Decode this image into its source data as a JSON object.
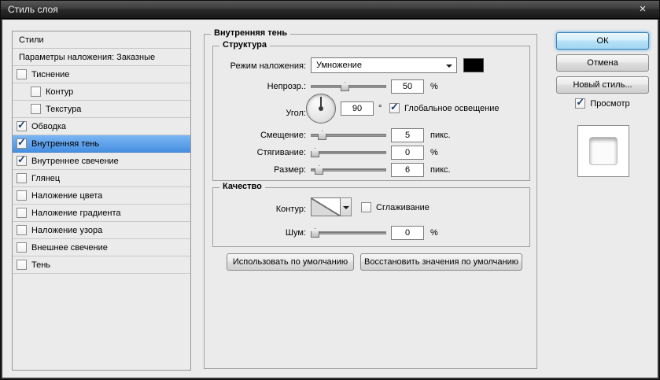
{
  "window": {
    "title": "Стиль слоя",
    "close_glyph": "×"
  },
  "styles_panel": {
    "header": "Стили",
    "blending_options": "Параметры наложения: Заказные",
    "items": [
      {
        "label": "Тиснение",
        "checked": false,
        "check": ""
      },
      {
        "label": "Контур",
        "checked": false,
        "check": ""
      },
      {
        "label": "Текстура",
        "checked": false,
        "check": ""
      },
      {
        "label": "Обводка",
        "checked": true,
        "check": "✓"
      },
      {
        "label": "Внутренняя тень",
        "checked": true,
        "check": "✓",
        "selected": true
      },
      {
        "label": "Внутреннее свечение",
        "checked": true,
        "check": "✓"
      },
      {
        "label": "Глянец",
        "checked": false,
        "check": ""
      },
      {
        "label": "Наложение цвета",
        "checked": false,
        "check": ""
      },
      {
        "label": "Наложение градиента",
        "checked": false,
        "check": ""
      },
      {
        "label": "Наложение узора",
        "checked": false,
        "check": ""
      },
      {
        "label": "Внешнее свечение",
        "checked": false,
        "check": ""
      },
      {
        "label": "Тень",
        "checked": false,
        "check": ""
      }
    ]
  },
  "effect": {
    "title": "Внутренняя тень",
    "structure": {
      "title": "Структура",
      "blend_mode": {
        "label": "Режим наложения:",
        "value": "Умножение",
        "color": "#000000"
      },
      "opacity": {
        "label": "Непрозр.:",
        "value": "50",
        "unit": "%"
      },
      "angle": {
        "label": "Угол:",
        "value": "90",
        "unit": "°"
      },
      "global_light": {
        "label": "Глобальное освещение",
        "checked": true,
        "check": "✓"
      },
      "distance": {
        "label": "Смещение:",
        "value": "5",
        "unit": "пикс."
      },
      "choke": {
        "label": "Стягивание:",
        "value": "0",
        "unit": "%"
      },
      "size": {
        "label": "Размер:",
        "value": "6",
        "unit": "пикс."
      }
    },
    "quality": {
      "title": "Качество",
      "contour": {
        "label": "Контур:"
      },
      "antialias": {
        "label": "Сглаживание",
        "checked": false,
        "check": ""
      },
      "noise": {
        "label": "Шум:",
        "value": "0",
        "unit": "%"
      }
    },
    "buttons": {
      "make_default": "Использовать по умолчанию",
      "reset_default": "Восстановить значения по умолчанию"
    }
  },
  "actions": {
    "ok": "ОК",
    "cancel": "Отмена",
    "new_style": "Новый стиль...",
    "preview": {
      "label": "Просмотр",
      "checked": true,
      "check": "✓"
    }
  },
  "colors": {
    "selection_blue": "#4690e2",
    "shadow_color": "#000000",
    "dialog_bg": "#ebebeb"
  }
}
